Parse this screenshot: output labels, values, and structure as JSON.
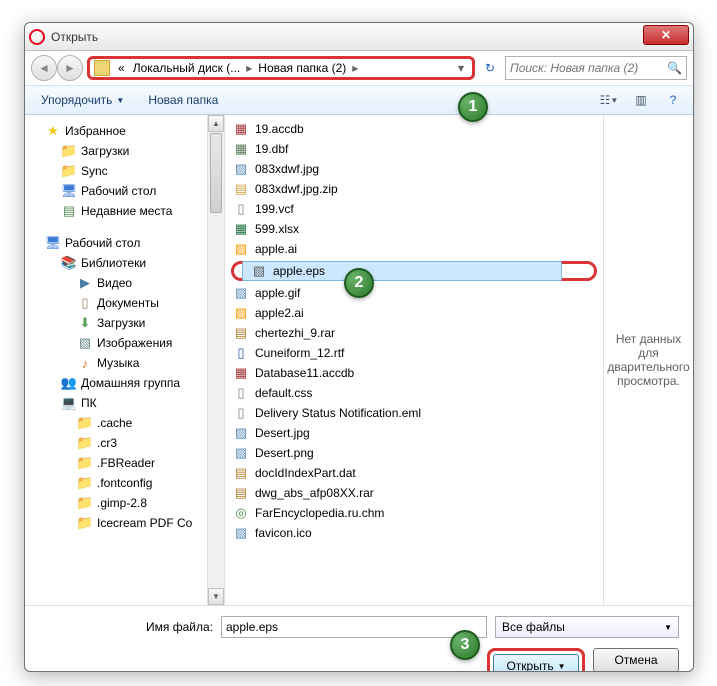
{
  "window": {
    "title": "Открыть"
  },
  "breadcrumb": {
    "prefix": "«",
    "seg1": "Локальный диск (...",
    "seg2": "Новая папка (2)"
  },
  "search": {
    "placeholder": "Поиск: Новая папка (2)"
  },
  "toolbar": {
    "organize": "Упорядочить",
    "new_folder": "Новая папка"
  },
  "tree": {
    "favorites": "Избранное",
    "downloads": "Загрузки",
    "sync": "Sync",
    "desktop": "Рабочий стол",
    "recent": "Недавние места",
    "desktop2": "Рабочий стол",
    "libraries": "Библиотеки",
    "video": "Видео",
    "documents": "Документы",
    "downloads2": "Загрузки",
    "images": "Изображения",
    "music": "Музыка",
    "homegroup": "Домашняя группа",
    "pc": "ПК",
    "cache": ".cache",
    "cr3": ".cr3",
    "fbreader": ".FBReader",
    "fontconfig": ".fontconfig",
    "gimp": ".gimp-2.8",
    "icecream": "Icecream PDF Co"
  },
  "files": [
    {
      "name": "19.accdb",
      "ic": "fic-accdb",
      "g": "▦"
    },
    {
      "name": "19.dbf",
      "ic": "fic-dbf",
      "g": "▦"
    },
    {
      "name": "083xdwf.jpg",
      "ic": "fic-jpg",
      "g": "▧"
    },
    {
      "name": "083xdwf.jpg.zip",
      "ic": "fic-zip",
      "g": "▤"
    },
    {
      "name": "199.vcf",
      "ic": "fic-vcf",
      "g": "▯"
    },
    {
      "name": "599.xlsx",
      "ic": "fic-xlsx",
      "g": "▦"
    },
    {
      "name": "apple.ai",
      "ic": "fic-ai",
      "g": "▧"
    },
    {
      "name": "apple.eps",
      "ic": "fic-eps",
      "g": "▧",
      "selected": true
    },
    {
      "name": "apple.gif",
      "ic": "fic-gif",
      "g": "▧"
    },
    {
      "name": "apple2.ai",
      "ic": "fic-ai",
      "g": "▧"
    },
    {
      "name": "chertezhi_9.rar",
      "ic": "fic-rar",
      "g": "▤"
    },
    {
      "name": "Cuneiform_12.rtf",
      "ic": "fic-rtf",
      "g": "▯"
    },
    {
      "name": "Database11.accdb",
      "ic": "fic-accdb",
      "g": "▦"
    },
    {
      "name": "default.css",
      "ic": "fic-css",
      "g": "▯"
    },
    {
      "name": "Delivery Status Notification.eml",
      "ic": "fic-eml",
      "g": "▯"
    },
    {
      "name": "Desert.jpg",
      "ic": "fic-jpg",
      "g": "▧"
    },
    {
      "name": "Desert.png",
      "ic": "fic-png",
      "g": "▧"
    },
    {
      "name": "docIdIndexPart.dat",
      "ic": "fic-dat",
      "g": "▤"
    },
    {
      "name": "dwg_abs_afp08XX.rar",
      "ic": "fic-rar",
      "g": "▤"
    },
    {
      "name": "FarEncyclopedia.ru.chm",
      "ic": "fic-chm",
      "g": "◎"
    },
    {
      "name": "favicon.ico",
      "ic": "fic-ico",
      "g": "▧"
    }
  ],
  "preview": {
    "text": "Нет данных для дварительного просмотра."
  },
  "footer": {
    "filename_label": "Имя файла:",
    "filename_value": "apple.eps",
    "filter": "Все файлы",
    "open": "Открыть",
    "cancel": "Отмена"
  },
  "badges": {
    "b1": "1",
    "b2": "2",
    "b3": "3"
  }
}
